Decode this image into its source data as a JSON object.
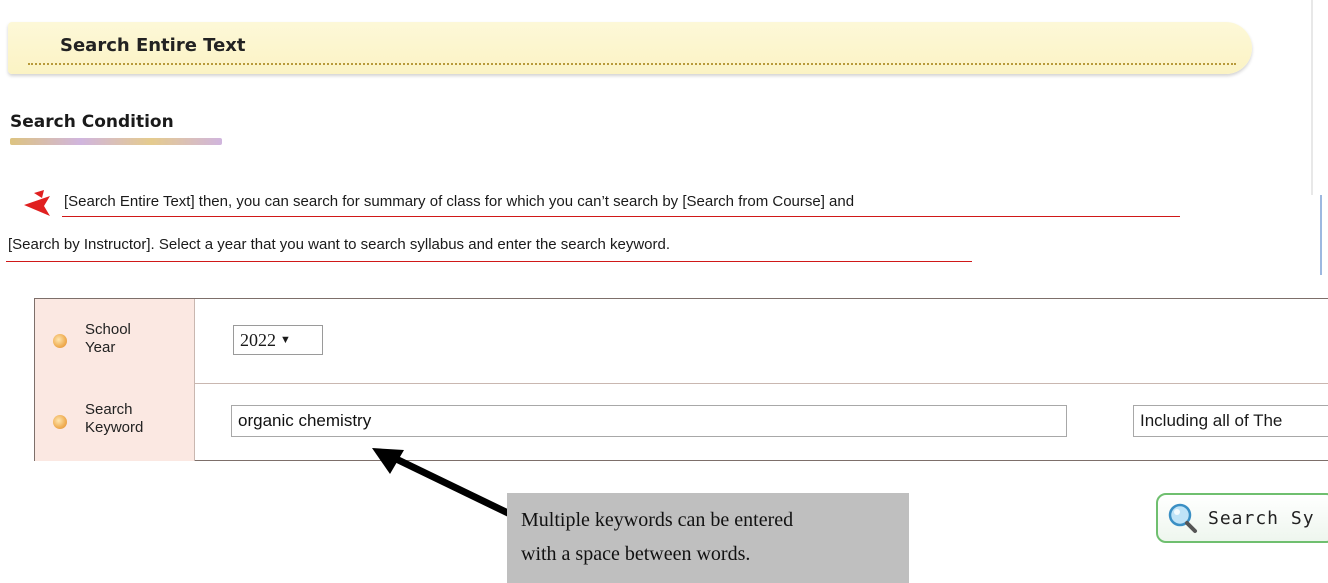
{
  "banner": {
    "title": "Search Entire Text"
  },
  "condition": {
    "title": "Search Condition"
  },
  "description": {
    "line1": "[Search Entire Text] then, you can search for summary of class for which you can’t search by [Search from Course] and",
    "line2": "[Search by Instructor]. Select a year that you want to search syllabus and enter the search keyword."
  },
  "form": {
    "year_label_1": "School",
    "year_label_2": "Year",
    "year_value": "2022",
    "keyword_label_1": "Search",
    "keyword_label_2": "Keyword",
    "keyword_value": "organic chemistry",
    "mode_value": "Including all of The"
  },
  "callout": {
    "line1": "Multiple keywords can be entered",
    "line2": "with a space between words."
  },
  "search_button": {
    "label": "Search Sy"
  },
  "colors": {
    "banner_bg": "#fbf3c4",
    "header_cell_bg": "#fbe8e2",
    "annotation_red": "#d01818",
    "button_border": "#6fbf6f",
    "callout_bg": "#bfbfbf"
  },
  "icons": [
    "bullet-arrow-icon",
    "orange-dot-icon",
    "magnifier-icon",
    "callout-arrow-icon"
  ]
}
